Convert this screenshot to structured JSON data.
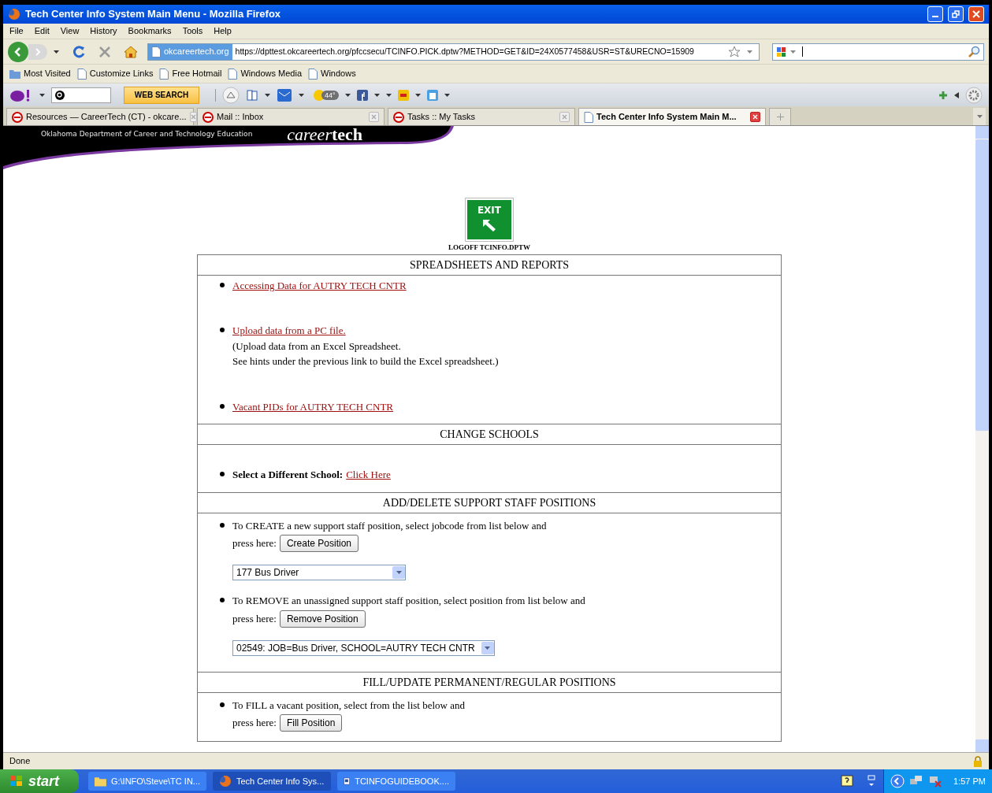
{
  "window": {
    "title": "Tech Center Info System Main Menu - Mozilla Firefox"
  },
  "menu": [
    "File",
    "Edit",
    "View",
    "History",
    "Bookmarks",
    "Tools",
    "Help"
  ],
  "nav": {
    "domain": "okcareertech.org",
    "url": "https://dpttest.okcareertech.org/pfccsecu/TCINFO.PICK.dptw?METHOD=GET&ID=24X0577458&USR=ST&URECNO=15909"
  },
  "bookmarks": [
    "Most Visited",
    "Customize Links",
    "Free Hotmail",
    "Windows Media",
    "Windows"
  ],
  "toolbar": {
    "search_button": "WEB SEARCH",
    "weather": "44°"
  },
  "tabs": [
    {
      "label": "Resources — CareerTech (CT) - okcare...",
      "selected": false
    },
    {
      "label": "Mail :: Inbox",
      "selected": false
    },
    {
      "label": "Tasks :: My Tasks",
      "selected": false
    },
    {
      "label": "Tech Center Info System Main M...",
      "selected": true
    }
  ],
  "page": {
    "org": "Oklahoma Department of Career and Technology Education",
    "logo_left": "career",
    "logo_right": "tech",
    "exit_sign": "EXIT",
    "logoff": "LOGOFF TCINFO.DPTW"
  },
  "sections": [
    {
      "title": "SPREADSHEETS AND REPORTS",
      "items": [
        {
          "kind": "link",
          "link": "Accessing Data for AUTRY TECH CNTR"
        },
        {
          "kind": "link",
          "link": "Upload data from a PC file.",
          "notes": [
            "(Upload data from an Excel Spreadsheet.",
            "See hints under the previous link to build the Excel spreadsheet.)"
          ]
        },
        {
          "kind": "link",
          "link": "Vacant PIDs for AUTRY TECH CNTR"
        }
      ]
    },
    {
      "title": "CHANGE SCHOOLS",
      "items": [
        {
          "kind": "label_link",
          "label": "Select a Different School:",
          "link": "Click Here"
        }
      ]
    },
    {
      "title": "ADD/DELETE SUPPORT STAFF POSITIONS",
      "items": [
        {
          "kind": "action",
          "text": "To CREATE a new support staff position, select jobcode from list below and",
          "prompt": "press here:",
          "button": "Create Position",
          "select": "177 Bus Driver"
        },
        {
          "kind": "action",
          "text": "To REMOVE an unassigned support staff position, select position from list below and",
          "prompt": "press here:",
          "button": "Remove Position",
          "select": "02549: JOB=Bus Driver, SCHOOL=AUTRY TECH CNTR"
        }
      ]
    },
    {
      "title": "FILL/UPDATE PERMANENT/REGULAR POSITIONS",
      "items": [
        {
          "kind": "action",
          "text": "To FILL a vacant position, select from the list below and",
          "prompt": "press here:",
          "button": "Fill Position"
        }
      ]
    }
  ],
  "status_bar": "Done",
  "taskbar": {
    "start": "start",
    "tasks": [
      {
        "label": "G:\\INFO\\Steve\\TC IN...",
        "selected": false
      },
      {
        "label": "Tech Center Info Sys...",
        "selected": true
      },
      {
        "label": "TCINFOGUIDEBOOK....",
        "selected": false
      }
    ],
    "clock": "1:57 PM"
  }
}
